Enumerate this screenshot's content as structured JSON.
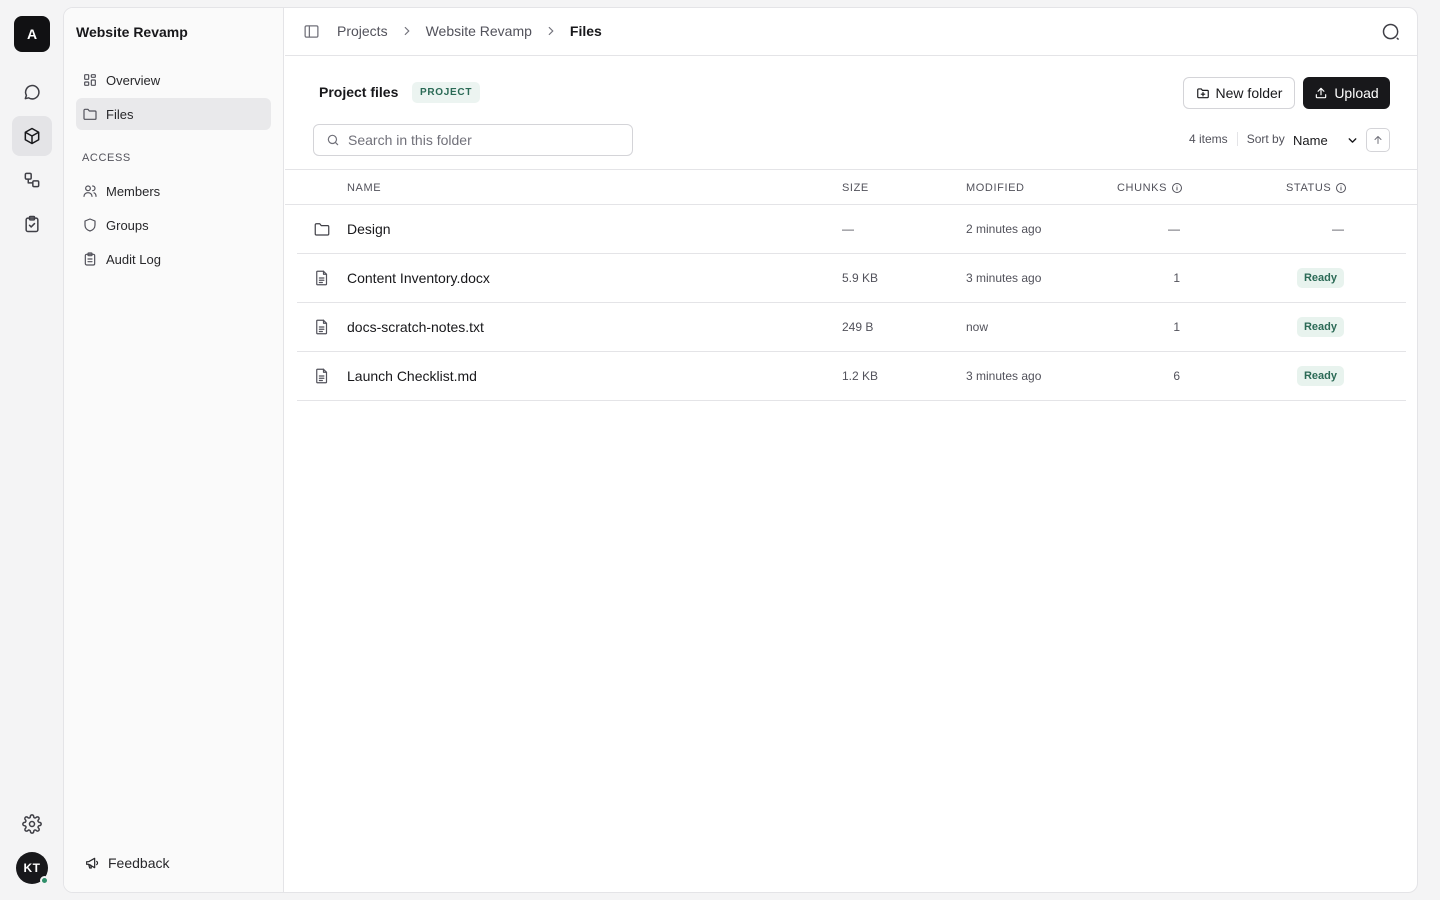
{
  "rail": {
    "logo": "A",
    "avatar": "KT",
    "icons": [
      "chat-icon",
      "cube-icon",
      "workflow-icon",
      "clipboard-check-icon",
      "gear-icon"
    ]
  },
  "sidebar": {
    "title": "Website Revamp",
    "nav": [
      {
        "label": "Overview",
        "icon": "grid-icon"
      },
      {
        "label": "Files",
        "icon": "folder-icon",
        "active": true
      }
    ],
    "access_heading": "ACCESS",
    "access": [
      {
        "label": "Members",
        "icon": "users-icon"
      },
      {
        "label": "Groups",
        "icon": "shield-icon"
      },
      {
        "label": "Audit Log",
        "icon": "clipboard-icon"
      }
    ],
    "feedback": "Feedback"
  },
  "breadcrumb": [
    "Projects",
    "Website Revamp",
    "Files"
  ],
  "header": {
    "title": "Project files",
    "badge": "PROJECT",
    "new_folder": "New folder",
    "upload": "Upload"
  },
  "search": {
    "placeholder": "Search in this folder",
    "value": ""
  },
  "list_meta": {
    "count": "4 items",
    "sort_label": "Sort by",
    "sort_value": "Name"
  },
  "table": {
    "columns": {
      "name": "NAME",
      "size": "SIZE",
      "modified": "MODIFIED",
      "chunks": "CHUNKS",
      "status": "STATUS"
    },
    "rows": [
      {
        "type": "folder",
        "name": "Design",
        "size": "—",
        "modified": "2 minutes ago",
        "chunks": "—",
        "status": "—"
      },
      {
        "type": "file",
        "name": "Content Inventory.docx",
        "size": "5.9 KB",
        "modified": "3 minutes ago",
        "chunks": "1",
        "status": "Ready"
      },
      {
        "type": "file",
        "name": "docs-scratch-notes.txt",
        "size": "249 B",
        "modified": "now",
        "chunks": "1",
        "status": "Ready"
      },
      {
        "type": "file",
        "name": "Launch Checklist.md",
        "size": "1.2 KB",
        "modified": "3 minutes ago",
        "chunks": "6",
        "status": "Ready"
      }
    ]
  },
  "colors": {
    "accent_dark": "#18181b",
    "badge_bg": "#ecf4f1",
    "badge_text": "#2b6a56",
    "online": "#2f8f6a"
  }
}
